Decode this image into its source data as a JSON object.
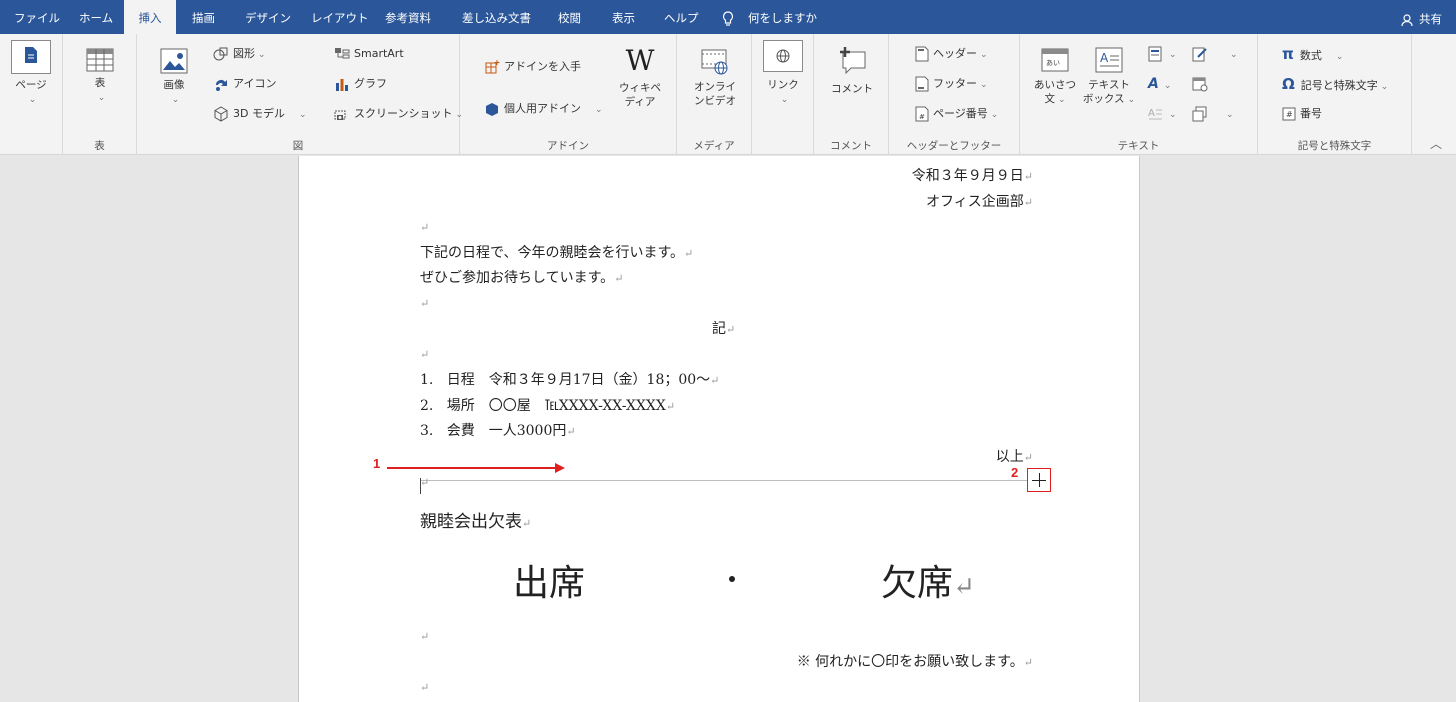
{
  "tabs": {
    "file": "ファイル",
    "home": "ホーム",
    "insert": "挿入",
    "draw": "描画",
    "design": "デザイン",
    "layout": "レイアウト",
    "references": "参考資料",
    "mailings": "差し込み文書",
    "review": "校閲",
    "view": "表示",
    "help": "ヘルプ",
    "tell_me": "何をしますか",
    "share": "共有"
  },
  "ribbon": {
    "pages": "ページ",
    "table": "表",
    "table_group": "表",
    "pictures": "画像",
    "shapes": "図形",
    "icons": "アイコン",
    "models3d": "3D モデル",
    "smartart": "SmartArt",
    "chart": "グラフ",
    "screenshot": "スクリーンショット",
    "illustrations_group": "図",
    "get_addins": "アドインを入手",
    "my_addins": "個人用アドイン",
    "wikipedia_1": "ウィキペ",
    "wikipedia_2": "ディア",
    "addins_group": "アドイン",
    "online_video_1": "オンライ",
    "online_video_2": "ンビデオ",
    "media_group": "メディア",
    "link": "リンク",
    "comment": "コメント",
    "comment_group": "コメント",
    "header": "ヘッダー",
    "footer": "フッター",
    "page_number": "ページ番号",
    "header_footer_group": "ヘッダーとフッター",
    "greeting_1": "あいさつ",
    "greeting_2": "文",
    "textbox_1": "テキスト",
    "textbox_2": "ボックス",
    "text_group": "テキスト",
    "equation": "数式",
    "symbol": "記号と特殊文字",
    "number": "番号",
    "symbols_group": "記号と特殊文字"
  },
  "document": {
    "date": "令和３年９月９日",
    "dept": "オフィス企画部",
    "line1": "下記の日程で、今年の親睦会を行います。",
    "line2": "ぜひご参加お待ちしています。",
    "ki": "記",
    "item1_num": "1.",
    "item1": "日程　令和３年９月17日（金）18；00～",
    "item2_num": "2.",
    "item2": "場所　〇〇屋　℡XXXX-XX-XXXX",
    "item3_num": "3.",
    "item3": "会費　一人3000円",
    "ijou": "以上",
    "table_title": "親睦会出欠表",
    "attend": "出席",
    "absent": "欠席",
    "note": "※ 何れかに〇印をお願い致します。",
    "para_mark": "↵"
  },
  "annotations": {
    "one": "1",
    "two": "2"
  },
  "colors": {
    "titlebar": "#2b579a",
    "ribbon": "#f3f3f3",
    "annotation": "#e02020"
  }
}
